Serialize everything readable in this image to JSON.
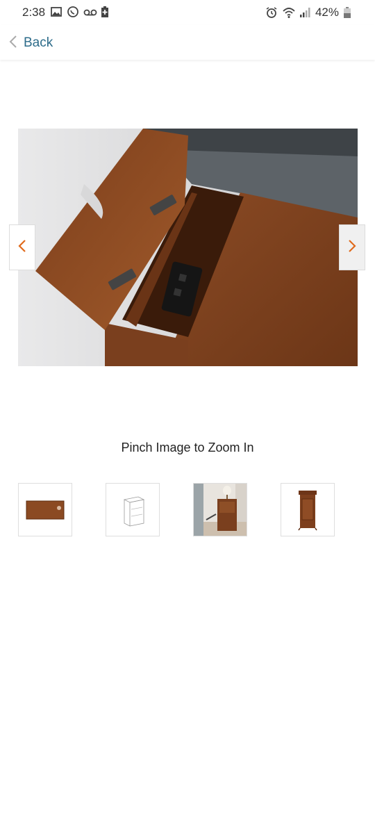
{
  "status_bar": {
    "time": "2:38",
    "battery_percent": "42%",
    "left_icons": [
      "gallery-icon",
      "whatsapp-icon",
      "voicemail-icon",
      "battery-saver-icon"
    ],
    "right_icons": [
      "alarm-icon",
      "wifi-icon",
      "signal-icon",
      "battery-icon"
    ]
  },
  "header": {
    "back_label": "Back"
  },
  "gallery": {
    "main_image_icon": "side-table-open-lid-photo",
    "prev_icon": "chevron-left-icon",
    "next_icon": "chevron-right-icon",
    "zoom_hint": "Pinch Image to Zoom In",
    "thumbnails": [
      {
        "icon": "table-top-view-thumbnail"
      },
      {
        "icon": "table-line-drawing-thumbnail"
      },
      {
        "icon": "table-in-room-thumbnail"
      },
      {
        "icon": "table-front-view-thumbnail"
      }
    ]
  },
  "colors": {
    "accent_link": "#2d6c8a",
    "arrow": "#e06a1b",
    "wood": "#7a3f1e"
  }
}
